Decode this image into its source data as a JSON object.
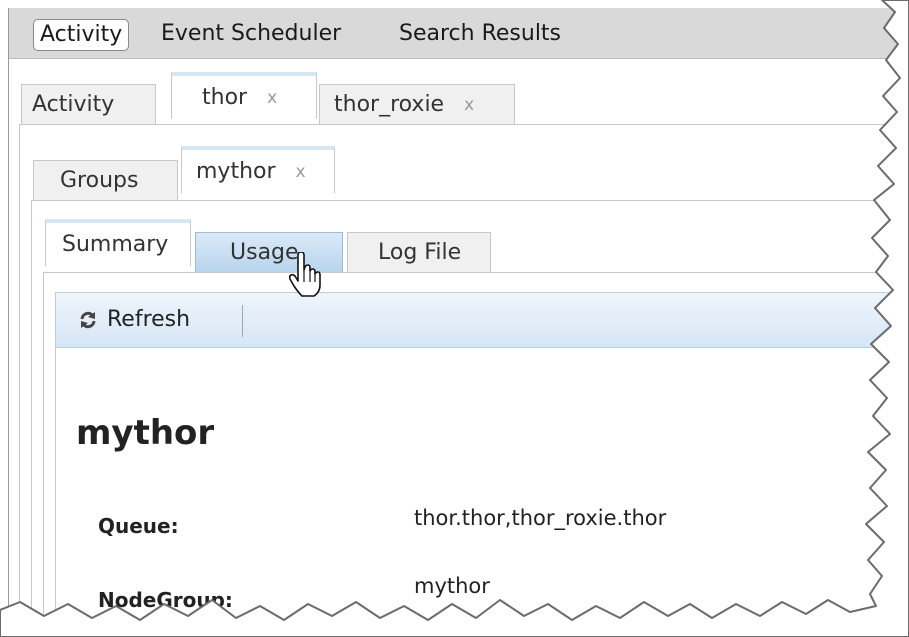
{
  "top_nav": {
    "items": [
      {
        "label": "Activity",
        "active": true
      },
      {
        "label": "Event Scheduler",
        "active": false
      },
      {
        "label": "Search Results",
        "active": false
      }
    ]
  },
  "cluster_tabs": [
    {
      "label": "Activity",
      "closable": false
    },
    {
      "label": "thor",
      "closable": true,
      "active": true
    },
    {
      "label": "thor_roxie",
      "closable": true
    }
  ],
  "group_tabs": [
    {
      "label": "Groups",
      "closable": false
    },
    {
      "label": "mythor",
      "closable": true,
      "active": true
    }
  ],
  "detail_tabs": [
    {
      "label": "Summary",
      "active": true
    },
    {
      "label": "Usage",
      "hovered": true
    },
    {
      "label": "Log File"
    }
  ],
  "close_glyph": "x",
  "toolbar": {
    "refresh_label": "Refresh",
    "refresh_icon": "refresh-icon"
  },
  "summary": {
    "title": "mythor",
    "fields": [
      {
        "label": "Queue:",
        "value": "thor.thor,thor_roxie.thor"
      },
      {
        "label": "NodeGroup:",
        "value": "mythor"
      }
    ]
  },
  "colors": {
    "toolbar_top": "#eef5fc",
    "toolbar_bottom": "#d6e6f5",
    "hover_tab": "#b8d4ee"
  }
}
